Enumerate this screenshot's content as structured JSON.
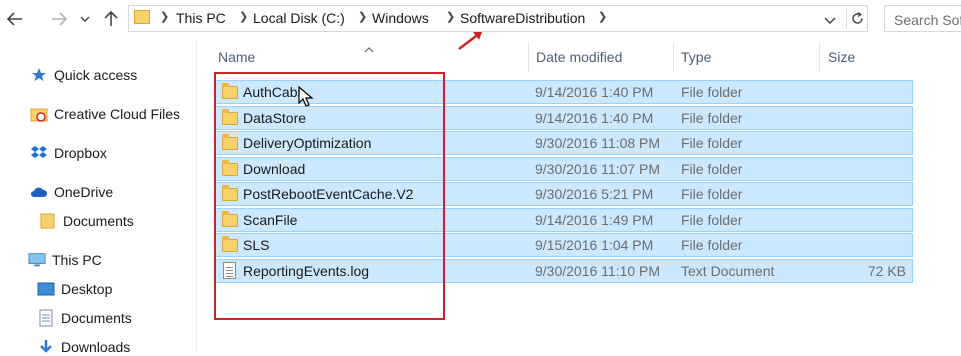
{
  "breadcrumb": [
    "This PC",
    "Local Disk (C:)",
    "Windows",
    "SoftwareDistribution"
  ],
  "search": {
    "placeholder": "Search Sof"
  },
  "columns": {
    "name": "Name",
    "date": "Date modified",
    "type": "Type",
    "size": "Size"
  },
  "nav": {
    "quick_access": "Quick access",
    "creative_cloud": "Creative Cloud Files",
    "dropbox": "Dropbox",
    "onedrive": "OneDrive",
    "onedrive_documents": "Documents",
    "this_pc": "This PC",
    "desktop": "Desktop",
    "documents": "Documents",
    "downloads": "Downloads"
  },
  "files": [
    {
      "name": "AuthCabs",
      "date": "9/14/2016 1:40 PM",
      "type": "File folder",
      "size": "",
      "icon": "folder-icon"
    },
    {
      "name": "DataStore",
      "date": "9/14/2016 1:40 PM",
      "type": "File folder",
      "size": "",
      "icon": "folder-icon"
    },
    {
      "name": "DeliveryOptimization",
      "date": "9/30/2016 11:08 PM",
      "type": "File folder",
      "size": "",
      "icon": "folder-icon"
    },
    {
      "name": "Download",
      "date": "9/30/2016 11:07 PM",
      "type": "File folder",
      "size": "",
      "icon": "folder-icon"
    },
    {
      "name": "PostRebootEventCache.V2",
      "date": "9/30/2016 5:21 PM",
      "type": "File folder",
      "size": "",
      "icon": "folder-icon"
    },
    {
      "name": "ScanFile",
      "date": "9/14/2016 1:49 PM",
      "type": "File folder",
      "size": "",
      "icon": "folder-icon"
    },
    {
      "name": "SLS",
      "date": "9/15/2016 1:04 PM",
      "type": "File folder",
      "size": "",
      "icon": "folder-icon"
    },
    {
      "name": "ReportingEvents.log",
      "date": "9/30/2016 11:10 PM",
      "type": "Text Document",
      "size": "72 KB",
      "icon": "text-document-icon"
    }
  ],
  "colors": {
    "selection": "#cce8ff",
    "selection_border": "#99d1ff",
    "highlight": "#d11f26",
    "header_text": "#4c607a"
  }
}
